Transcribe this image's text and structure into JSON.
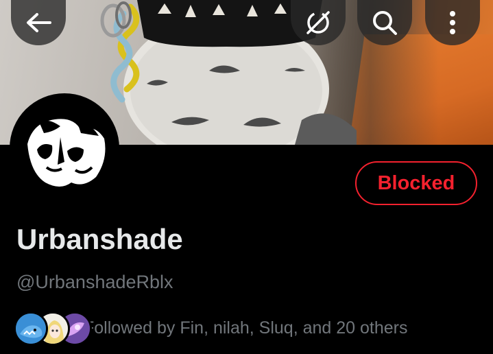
{
  "header": {
    "back_icon": "arrow-left-icon",
    "grok_icon": "grok-icon",
    "search_icon": "search-icon",
    "more_icon": "more-vertical-icon"
  },
  "profile": {
    "display_name": "Urbanshade",
    "handle": "@UrbanshadeRblx",
    "relationship_button": "Blocked",
    "followed_by": "Followed by Fin, nilah, Sluq, and 20 others"
  },
  "colors": {
    "background": "#000000",
    "blocked_red": "#f4212e",
    "primary_text": "#e7e9ea",
    "secondary_text": "#71767b"
  }
}
